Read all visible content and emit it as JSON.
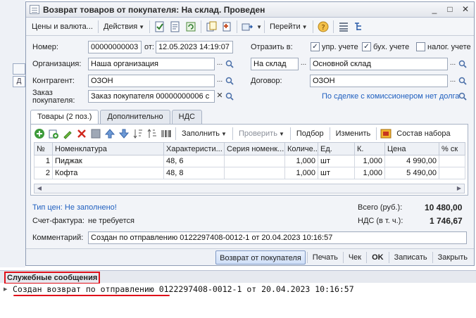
{
  "window": {
    "title": "Возврат товаров от покупателя: На склад. Проведен",
    "min_symbol": "_",
    "max_symbol": "□",
    "close_symbol": "✕"
  },
  "toolbar": {
    "prices_label": "Цены и валюта...",
    "actions_label": "Действия",
    "go_label": "Перейти",
    "help_symbol": "?"
  },
  "form": {
    "number_label": "Номер:",
    "number_value": "00000000003",
    "date_label": "от:",
    "date_value": "12.05.2023 14:19:07",
    "reflect_label": "Отразить в:",
    "upr_label": "упр. учете",
    "buh_label": "бух. учете",
    "nalog_label": "налог. учете",
    "org_label": "Организация:",
    "org_value": "Наша организация",
    "op_value": "На склад",
    "warehouse_value": "Основной склад",
    "contr_label": "Контрагент:",
    "contr_value": "ОЗОН",
    "contract_label": "Договор:",
    "contract_value": "ОЗОН",
    "order_label_1": "Заказ",
    "order_label_2": "покупателя:",
    "order_value": "Заказ покупателя 00000000006 с",
    "commission_link": "По сделке с комиссионером нет долга"
  },
  "tabs": [
    {
      "label": "Товары (2 поз.)"
    },
    {
      "label": "Дополнительно"
    },
    {
      "label": "НДС"
    }
  ],
  "gridbar": {
    "fill_label": "Заполнить",
    "check_label": "Проверить",
    "select_label": "Подбор",
    "change_label": "Изменить",
    "set_label": "Состав набора"
  },
  "grid": {
    "headers": [
      "№",
      "Номенклатура",
      "Характеристи...",
      "Серия номенк...",
      "Количе...",
      "Ед.",
      "К.",
      "Цена",
      "% ск"
    ],
    "rows": [
      {
        "n": "1",
        "item": "Пиджак",
        "char": "48, 6",
        "series": "",
        "qty": "1,000",
        "unit": "шт",
        "k": "1,000",
        "price": "4 990,00"
      },
      {
        "n": "2",
        "item": "Кофта",
        "char": "48, 8",
        "series": "",
        "qty": "1,000",
        "unit": "шт",
        "k": "1,000",
        "price": "5 490,00"
      }
    ]
  },
  "summary": {
    "price_type_link": "Тип цен: Не заполнено!",
    "total_label": "Всего (руб.):",
    "total_value": "10 480,00",
    "invoice_label": "Счет-фактура:",
    "invoice_value": "не требуется",
    "vat_label": "НДС (в т. ч.):",
    "vat_value": "1 746,67",
    "comment_label": "Комментарий:",
    "comment_value": "Создан по отправлению 0122297408-0012-1 от 20.04.2023 10:16:57"
  },
  "bottom": {
    "return_label": "Возврат от покупателя",
    "print_label": "Печать",
    "check_label": "Чек",
    "ok_label": "OK",
    "save_label": "Записать",
    "close_label": "Закрыть"
  },
  "messages": {
    "title": "Служебные сообщения",
    "line": "Создан возврат по отправлению 0122297408-0012-1 от 20.04.2023 10:16:57"
  },
  "background": {
    "side_tab": "Д"
  },
  "colors": {
    "accent_blue": "#1f5fbf",
    "highlight_red": "#e0101a",
    "window_bg": "#f2f4f8"
  }
}
